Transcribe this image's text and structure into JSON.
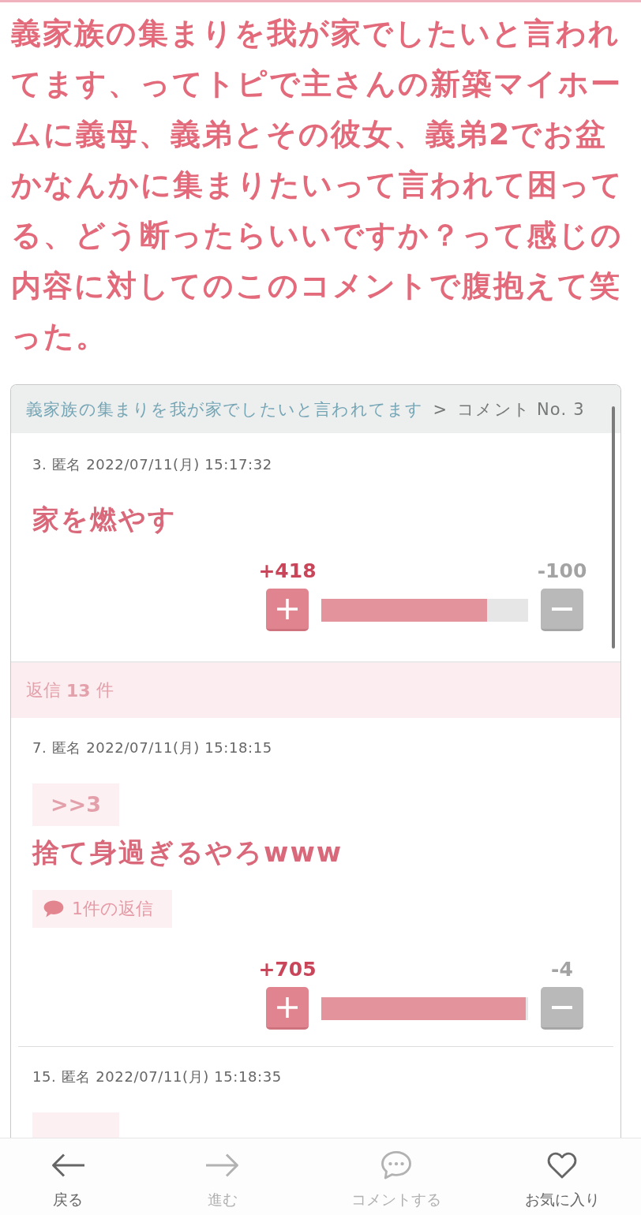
{
  "title": "義家族の集まりを我が家でしたいと言われてます、ってトピで主さんの新築マイホームに義母、義弟とその彼女、義弟2でお盆かなんかに集まりたいって言われて困ってる、どう断ったらいいですか？って感じの内容に対してのこのコメントで腹抱えて笑った。",
  "card": {
    "breadcrumb": {
      "link": "義家族の集まりを我が家でしたいと言われてます",
      "separator": ">",
      "current": "コメント No. 3"
    },
    "comment": {
      "meta": "3. 匿名 2022/07/11(月) 15:17:32",
      "body": "家を燃やす",
      "votes": {
        "plus": "+418",
        "minus": "-100",
        "level": 0.8
      }
    },
    "replies_header": "返信 **13** 件",
    "replies": [
      {
        "meta": "7. 匿名 2022/07/11(月) 15:18:15",
        "reply_tag": true,
        "anchor": ">>3",
        "body": "捨て身過ぎるやろwww",
        "reply_count": "1件の返信",
        "votes": {
          "plus": "+705",
          "minus": "-4",
          "level": 0.99
        }
      },
      {
        "meta": "15. 匿名 2022/07/11(月) 15:18:35",
        "reply_tag": true
      }
    ]
  },
  "bottom_nav": [
    {
      "kind": "back",
      "label": "戻る",
      "disabled": false
    },
    {
      "kind": "forward",
      "label": "進む",
      "disabled": true
    },
    {
      "kind": "comment",
      "label": "コメントする",
      "disabled": true
    },
    {
      "kind": "favorite",
      "label": "お気に入り",
      "disabled": false
    }
  ]
}
